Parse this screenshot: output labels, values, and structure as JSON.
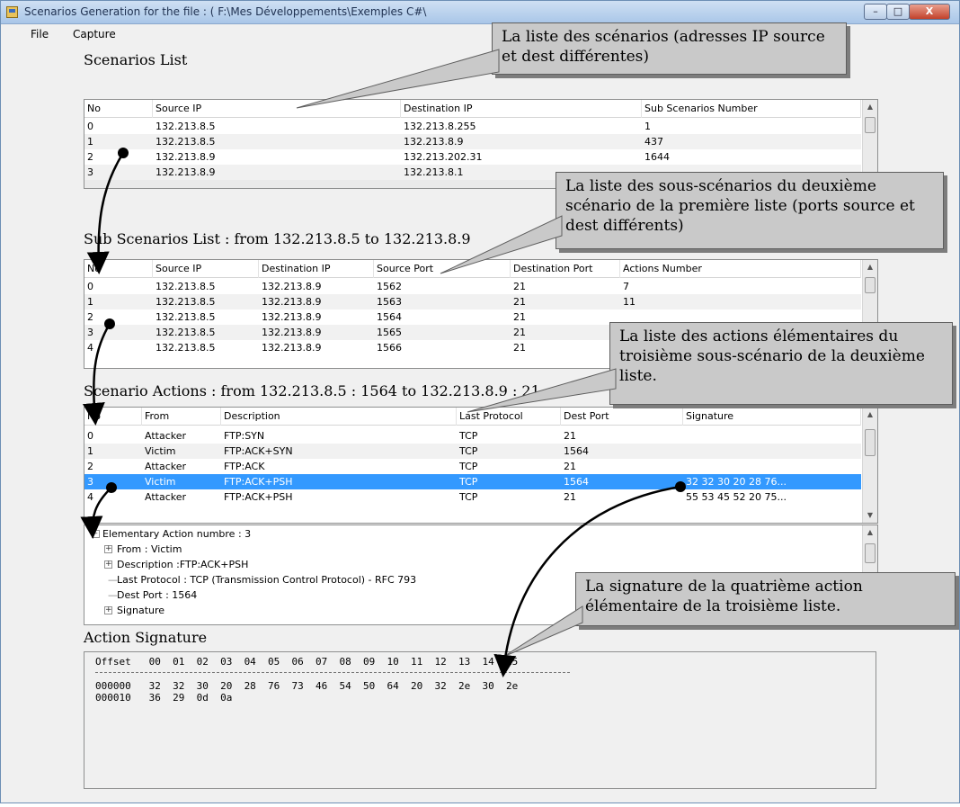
{
  "window": {
    "title": "Scenarios Generation for the file : ( F:\\Mes Développements\\Exemples C#\\"
  },
  "menu": {
    "file": "File",
    "capture": "Capture"
  },
  "scenarios": {
    "title": "Scenarios List",
    "columns": [
      "No",
      "Source IP",
      "Destination IP",
      "Sub Scenarios Number"
    ],
    "rows": [
      [
        "0",
        "132.213.8.5",
        "132.213.8.255",
        "1"
      ],
      [
        "1",
        "132.213.8.5",
        "132.213.8.9",
        "437"
      ],
      [
        "2",
        "132.213.8.9",
        "132.213.202.31",
        "1644"
      ],
      [
        "3",
        "132.213.8.9",
        "132.213.8.1",
        ""
      ]
    ]
  },
  "sub_scenarios": {
    "title": "Sub Scenarios List : from 132.213.8.5  to 132.213.8.9",
    "columns": [
      "No",
      "Source IP",
      "Destination IP",
      "Source Port",
      "Destination Port",
      "Actions Number"
    ],
    "rows": [
      [
        "0",
        "132.213.8.5",
        "132.213.8.9",
        "1562",
        "21",
        "7"
      ],
      [
        "1",
        "132.213.8.5",
        "132.213.8.9",
        "1563",
        "21",
        "11"
      ],
      [
        "2",
        "132.213.8.5",
        "132.213.8.9",
        "1564",
        "21",
        ""
      ],
      [
        "3",
        "132.213.8.5",
        "132.213.8.9",
        "1565",
        "21",
        ""
      ],
      [
        "4",
        "132.213.8.5",
        "132.213.8.9",
        "1566",
        "21",
        ""
      ]
    ]
  },
  "actions": {
    "title": "Scenario Actions : from 132.213.8.5 : 1564  to 132.213.8.9 : 21",
    "columns": [
      "No",
      "From",
      "Description",
      "Last Protocol",
      "Dest Port",
      "Signature"
    ],
    "rows": [
      [
        "0",
        "Attacker",
        "FTP:SYN",
        "TCP",
        "21",
        ""
      ],
      [
        "1",
        "Victim",
        "FTP:ACK+SYN",
        "TCP",
        "1564",
        ""
      ],
      [
        "2",
        "Attacker",
        "FTP:ACK",
        "TCP",
        "21",
        ""
      ],
      [
        "3",
        "Victim",
        "FTP:ACK+PSH",
        "TCP",
        "1564",
        "32 32 30 20 28 76..."
      ],
      [
        "4",
        "Attacker",
        "FTP:ACK+PSH",
        "TCP",
        "21",
        "55 53 45 52 20 75..."
      ]
    ],
    "selected_row": 3
  },
  "tree": {
    "root": "Elementary Action numbre  : 3",
    "items": [
      {
        "label": "From : Victim",
        "expander": "+"
      },
      {
        "label": "Description :FTP:ACK+PSH",
        "expander": "+"
      },
      {
        "label": "Last Protocol  :  TCP  (Transmission Control Protocol) - RFC 793",
        "expander": ""
      },
      {
        "label": "Dest Port  :  1564",
        "expander": ""
      },
      {
        "label": "Signature",
        "expander": "+"
      }
    ]
  },
  "signature": {
    "title": "Action Signature",
    "header": "Offset   00  01  02  03  04  05  06  07  08  09  10  11  12  13  14  15",
    "separator": "------------------------------------------------------------------------------------",
    "lines": [
      "000000   32  32  30  20  28  76  73  46  54  50  64  20  32  2e  30  2e",
      "000010   36  29  0d  0a"
    ]
  },
  "callouts": {
    "scenarios": "La liste des scénarios (adresses IP source et dest différentes)",
    "sub_scenarios": "La liste des sous-scénarios du deuxième scénario de la première liste (ports source et dest différents)",
    "actions": "La liste des actions élémentaires du troisième  sous-scénario de la deuxième liste.",
    "signature": "La signature de la quatrième action élémentaire de la troisième liste."
  },
  "colors": {
    "selection": "#3399ff",
    "callout_bg": "#c9c9c9"
  }
}
